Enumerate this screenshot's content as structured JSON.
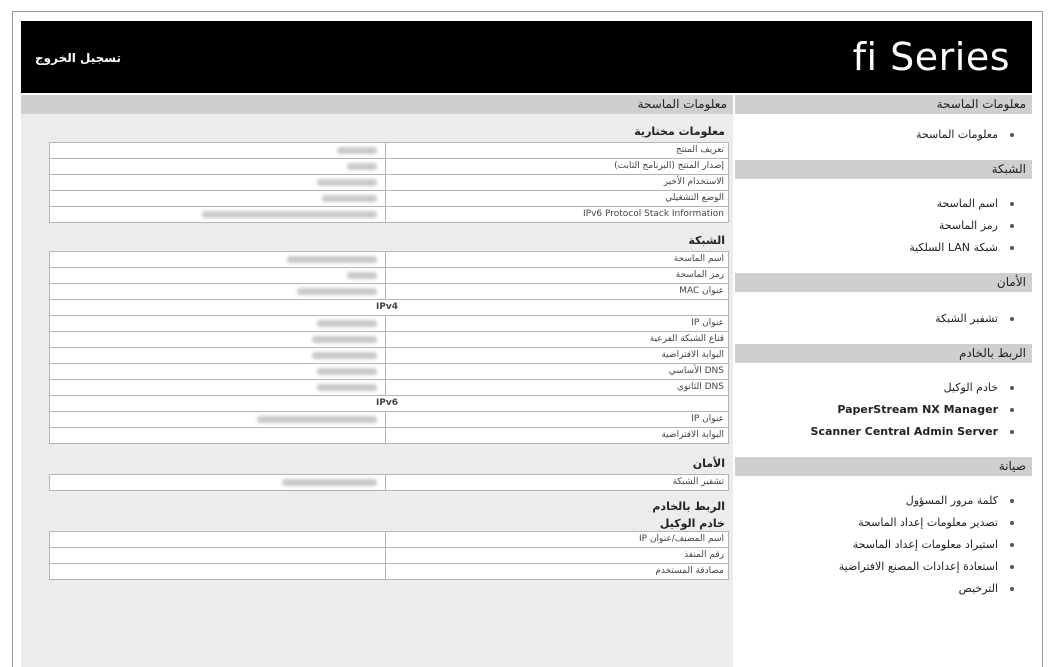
{
  "header": {
    "logo": "fi Series",
    "logout": "تسجيل الخروج"
  },
  "main": {
    "title": "معلومات الماسحة",
    "sections": [
      {
        "heading": "معلومات مختارية",
        "rows": [
          {
            "label": "تعريف المنتج",
            "w": 40
          },
          {
            "label": "إصدار المنتج (البرنامج الثابت)",
            "w": 30
          },
          {
            "label": "الاستخدام الأخير",
            "w": 60
          },
          {
            "label": "الوضع التشغيلي",
            "w": 55
          },
          {
            "label": "IPv6 Protocol Stack Information",
            "w": 175
          }
        ]
      },
      {
        "heading": "الشبكة",
        "rows": [
          {
            "label": "اسم الماسحة",
            "w": 90
          },
          {
            "label": "رمز الماسحة",
            "w": 30
          },
          {
            "label": "عنوان MAC",
            "w": 80
          },
          {
            "label": "IPv4",
            "center": true
          },
          {
            "label": "عنوان IP",
            "w": 60
          },
          {
            "label": "قناع الشبكة الفرعية",
            "w": 65
          },
          {
            "label": "البوابة الافتراضية",
            "w": 65
          },
          {
            "label": "DNS الأساسي",
            "w": 60
          },
          {
            "label": "DNS الثانوي",
            "w": 60
          },
          {
            "label": "IPv6",
            "center": true
          },
          {
            "label": "عنوان IP",
            "w": 120
          },
          {
            "label": "البوابة الافتراضية",
            "w": 0
          }
        ]
      },
      {
        "heading": "الأمان",
        "rows": [
          {
            "label": "تشفير الشبكة",
            "w": 95
          }
        ]
      },
      {
        "heading": "الربط بالخادم",
        "subheading": "خادم الوكيل",
        "rows": [
          {
            "label": "اسم المضيف/عنوان IP",
            "w": 0
          },
          {
            "label": "رقم المنفذ",
            "w": 0
          },
          {
            "label": "مصادقة المستخدم",
            "w": 0
          }
        ]
      }
    ]
  },
  "sidebar": {
    "groups": [
      {
        "title": "معلومات الماسحة",
        "items": [
          {
            "label": "معلومات الماسحة"
          }
        ]
      },
      {
        "title": "الشبكة",
        "items": [
          {
            "label": "اسم الماسحة"
          },
          {
            "label": "رمز الماسحة"
          },
          {
            "label": "شبكة LAN السلكية"
          }
        ]
      },
      {
        "title": "الأمان",
        "items": [
          {
            "label": "تشفير الشبكة"
          }
        ]
      },
      {
        "title": "الربط بالخادم",
        "items": [
          {
            "label": "خادم الوكيل"
          },
          {
            "label": "PaperStream NX Manager",
            "bold": true
          },
          {
            "label": "Scanner Central Admin Server",
            "bold": true
          }
        ]
      },
      {
        "title": "صيانة",
        "items": [
          {
            "label": "كلمة مرور المسؤول"
          },
          {
            "label": "تصدير معلومات إعداد الماسحة"
          },
          {
            "label": "استيراد معلومات إعداد الماسحة"
          },
          {
            "label": "استعادة إعدادات المصنع الافتراضية"
          },
          {
            "label": "الترخيص"
          }
        ]
      }
    ]
  }
}
